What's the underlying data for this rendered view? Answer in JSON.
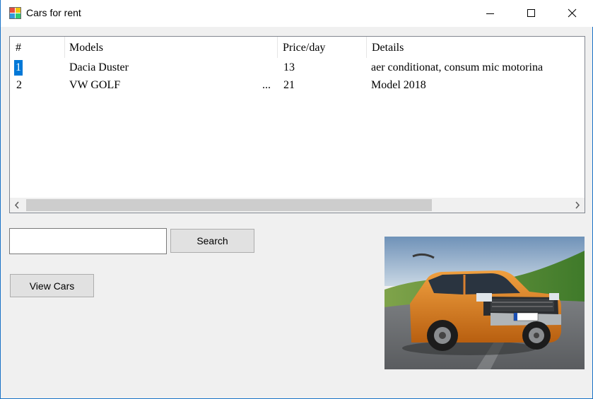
{
  "window": {
    "title": "Cars for rent",
    "app_icon": "winforms-app-icon",
    "controls": [
      "minimize-icon",
      "maximize-icon",
      "close-icon"
    ]
  },
  "listview": {
    "columns": [
      "#",
      "Models",
      "Price/day",
      "Details"
    ],
    "rows": [
      [
        "1",
        "Dacia Duster",
        "13",
        "aer conditionat, consum mic motorina"
      ],
      [
        "2",
        "VW GOLF",
        "21",
        "Model 2018"
      ]
    ],
    "truncation_marker": "...",
    "selection_color": "#0078d7"
  },
  "search": {
    "value": "",
    "placeholder": "",
    "button_label": "Search"
  },
  "view_cars_label": "View Cars",
  "photo": {
    "subject": "orange Dacia Duster driving on a road",
    "plate": "DAC 85"
  },
  "colors": {
    "window_bg": "#f0f0f0",
    "titlebar_bg": "#ffffff",
    "button_bg": "#e1e1e1",
    "border_accent": "#1a73c7",
    "car_body": "#d97a1a"
  }
}
